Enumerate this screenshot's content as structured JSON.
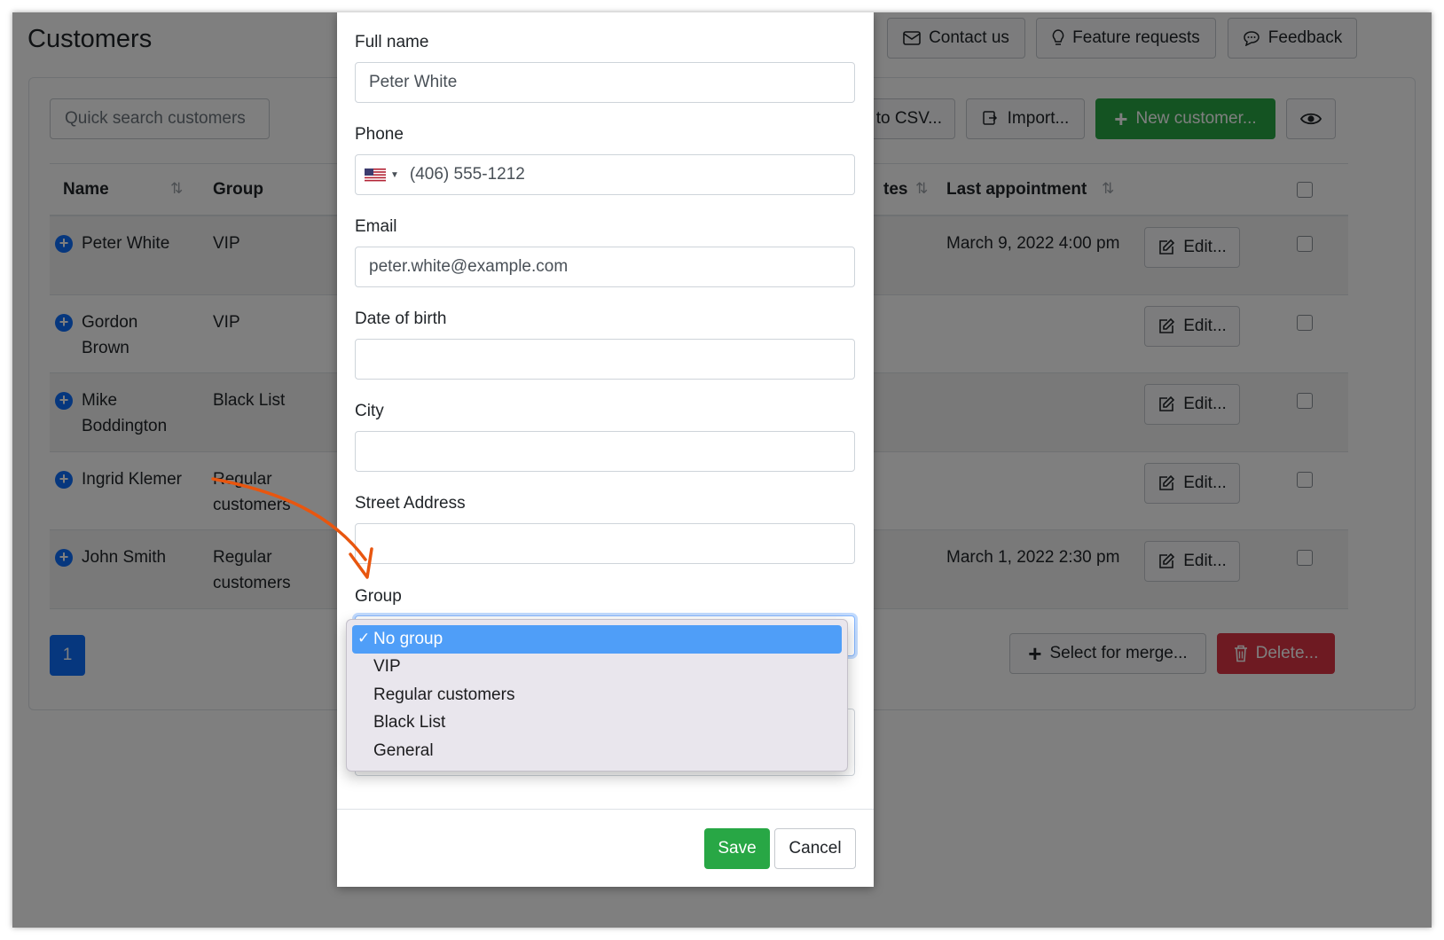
{
  "page": {
    "title": "Customers"
  },
  "top_buttons": {
    "contact": "Contact us",
    "features": "Feature requests",
    "feedback": "Feedback"
  },
  "toolbar": {
    "search_placeholder": "Quick search customers",
    "export": "to CSV...",
    "import": "Import...",
    "new_customer": "New customer..."
  },
  "table": {
    "columns": [
      "Name",
      "Group",
      "tes",
      "Last appointment"
    ],
    "edit_label": "Edit...",
    "rows": [
      {
        "name": "Peter White",
        "group": "VIP",
        "last": "March 9, 2022 4:00 pm"
      },
      {
        "name": "Gordon Brown",
        "group": "VIP",
        "last": ""
      },
      {
        "name": "Mike Boddington",
        "group": "Black List",
        "last": ""
      },
      {
        "name": "Ingrid Klemer",
        "group": "Regular customers",
        "last": ""
      },
      {
        "name": "John Smith",
        "group": "Regular customers",
        "last": "March 1, 2022 2:30 pm"
      }
    ]
  },
  "pagination": {
    "current": "1"
  },
  "bulk": {
    "merge": "Select for merge...",
    "delete": "Delete..."
  },
  "modal": {
    "full_name_label": "Full name",
    "full_name": "Peter White",
    "phone_label": "Phone",
    "phone": "(406) 555-1212",
    "email_label": "Email",
    "email": "peter.white@example.com",
    "dob_label": "Date of birth",
    "city_label": "City",
    "street_label": "Street Address",
    "group_label": "Group",
    "group_options": [
      "No group",
      "VIP",
      "Regular customers",
      "Black List",
      "General"
    ],
    "selected_index": 0,
    "check_mark": "✓",
    "save": "Save",
    "cancel": "Cancel"
  },
  "colors": {
    "primary": "#0d6efd",
    "success": "#28a745",
    "danger": "#dc3545",
    "annotation": "#e8560f",
    "option_selected": "#4f9ef8"
  }
}
